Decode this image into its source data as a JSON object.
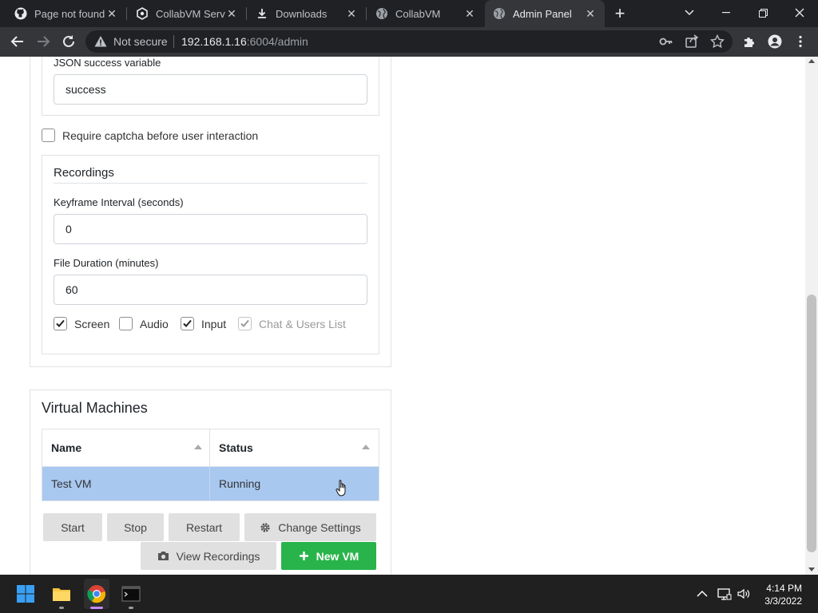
{
  "browser": {
    "tabs": [
      {
        "title": "Page not found",
        "icon": "github-icon"
      },
      {
        "title": "CollabVM Server",
        "icon": "collabvm-icon"
      },
      {
        "title": "Downloads",
        "icon": "download-icon"
      },
      {
        "title": "CollabVM",
        "icon": "globe-icon"
      },
      {
        "title": "Admin Panel",
        "icon": "globe-icon",
        "active": true
      }
    ],
    "address": {
      "security": "Not secure",
      "host": "192.168.1.16",
      "path": ":6004/admin"
    }
  },
  "settings": {
    "json_success_label": "JSON success variable",
    "json_success_value": "success",
    "captcha_label": "Require captcha before user interaction",
    "captcha_checked": false
  },
  "recordings": {
    "title": "Recordings",
    "keyframe_label": "Keyframe Interval (seconds)",
    "keyframe_value": "0",
    "duration_label": "File Duration (minutes)",
    "duration_value": "60",
    "options": {
      "screen": {
        "label": "Screen",
        "checked": true
      },
      "audio": {
        "label": "Audio",
        "checked": false
      },
      "input": {
        "label": "Input",
        "checked": true
      },
      "chat": {
        "label": "Chat & Users List",
        "checked": true,
        "disabled": true
      }
    }
  },
  "vms": {
    "title": "Virtual Machines",
    "columns": [
      "Name",
      "Status"
    ],
    "rows": [
      {
        "name": "Test VM",
        "status": "Running"
      }
    ],
    "buttons": {
      "start": "Start",
      "stop": "Stop",
      "restart": "Restart",
      "change_settings": "Change Settings",
      "view_recordings": "View Recordings",
      "new_vm": "New VM"
    }
  },
  "taskbar": {
    "time": "4:14 PM",
    "date": "3/3/2022"
  },
  "colors": {
    "selected_row": "#a8c8f0",
    "new_vm_button": "#28b44a"
  }
}
